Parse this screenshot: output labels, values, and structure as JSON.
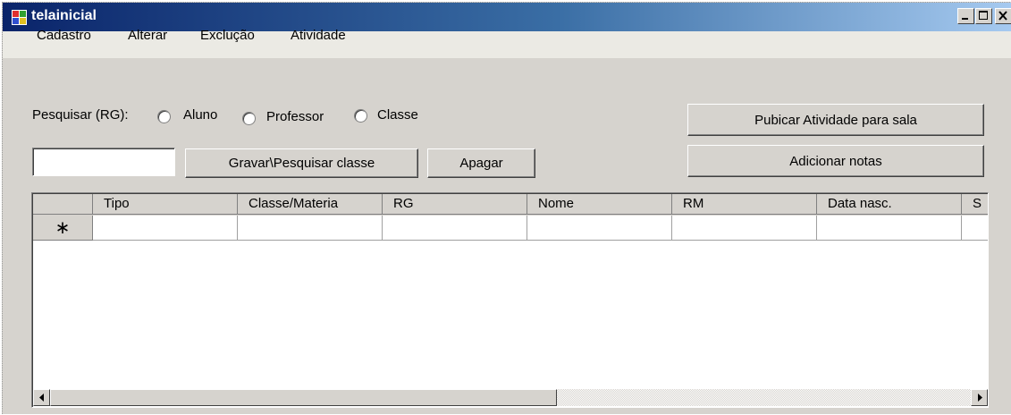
{
  "window": {
    "title": "telainicial",
    "titlebar_colors": [
      "#0a246a",
      "#a6caf0"
    ]
  },
  "menu": {
    "items": [
      "Cadastro",
      "Alterar",
      "Exclução",
      "Atividade"
    ]
  },
  "search": {
    "label": "Pesquisar (RG):",
    "options": [
      {
        "label": "Aluno",
        "checked": false
      },
      {
        "label": "Professor",
        "checked": false
      },
      {
        "label": "Classe",
        "checked": false
      }
    ],
    "input_value": ""
  },
  "buttons": {
    "save_search": "Gravar\\Pesquisar classe",
    "delete": "Apagar",
    "publish": "Pubicar Atividade para sala",
    "add_grades": "Adicionar notas"
  },
  "grid": {
    "columns": [
      "Tipo",
      "Classe/Materia",
      "RG",
      "Nome",
      "RM",
      "Data nasc.",
      "S"
    ],
    "new_row_marker": "∗",
    "rows": []
  }
}
